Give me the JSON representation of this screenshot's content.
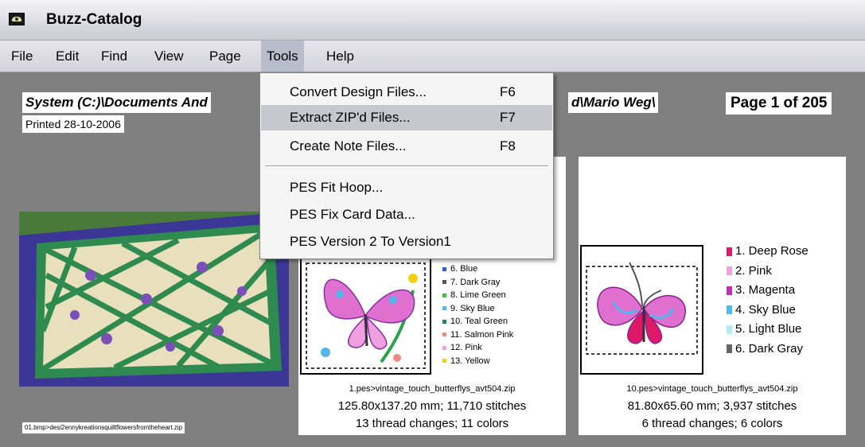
{
  "window": {
    "title": "Buzz-Catalog"
  },
  "menubar": {
    "items": [
      {
        "label": "File"
      },
      {
        "label": "Edit"
      },
      {
        "label": "Find"
      },
      {
        "label": "View"
      },
      {
        "label": "Page"
      },
      {
        "label": "Tools"
      },
      {
        "label": "Help"
      }
    ],
    "active": "Tools"
  },
  "tools_menu": {
    "items": [
      {
        "label": "Convert Design Files...",
        "shortcut": "F6"
      },
      {
        "label": "Extract ZIP'd Files...",
        "shortcut": "F7",
        "highlighted": true
      },
      {
        "label": "Create Note Files...",
        "shortcut": "F8"
      },
      {
        "label": "PES Fit Hoop..."
      },
      {
        "label": "PES Fix Card Data..."
      },
      {
        "label": "PES Version 2 To Version1"
      }
    ]
  },
  "page": {
    "path_left": "System (C:)\\Documents And",
    "path_right": "d\\Mario Weg\\",
    "printed": "Printed 28-10-2006",
    "page_number": "Page 1 of 205"
  },
  "quilt": {
    "caption": "01.bmp>desi2ennykreationsquiltflowersfromtheheart.zip"
  },
  "card1": {
    "legend": [
      {
        "label": "6.  Blue",
        "color": "#2f5fe0"
      },
      {
        "label": "7.  Dark Gray",
        "color": "#555555"
      },
      {
        "label": "8.  Lime Green",
        "color": "#44c040"
      },
      {
        "label": "9.  Sky Blue",
        "color": "#50b8ea"
      },
      {
        "label": "10. Teal Green",
        "color": "#1e8a5a"
      },
      {
        "label": "11. Salmon Pink",
        "color": "#f08a80"
      },
      {
        "label": "12. Pink",
        "color": "#f0a0e0"
      },
      {
        "label": "13. Yellow",
        "color": "#f0d010"
      }
    ],
    "filename": "1.pes>vintage_touch_butterflys_avt504.zip",
    "dimensions": "125.80x137.20 mm; 11,710 stitches",
    "summary": "13 thread changes; 11 colors"
  },
  "card2": {
    "legend": [
      {
        "label": "1.   Deep Rose",
        "color": "#e0186a"
      },
      {
        "label": "2.   Pink",
        "color": "#f0a0e0"
      },
      {
        "label": "3.   Magenta",
        "color": "#c030b0"
      },
      {
        "label": "4.   Sky Blue",
        "color": "#50b8ea"
      },
      {
        "label": "5.   Light Blue",
        "color": "#b0ecf6"
      },
      {
        "label": "6.   Dark Gray",
        "color": "#666666"
      }
    ],
    "filename": "10.pes>vintage_touch_butterflys_avt504.zip",
    "dimensions": "81.80x65.60 mm; 3,937 stitches",
    "summary": "6 thread changes; 6 colors"
  }
}
